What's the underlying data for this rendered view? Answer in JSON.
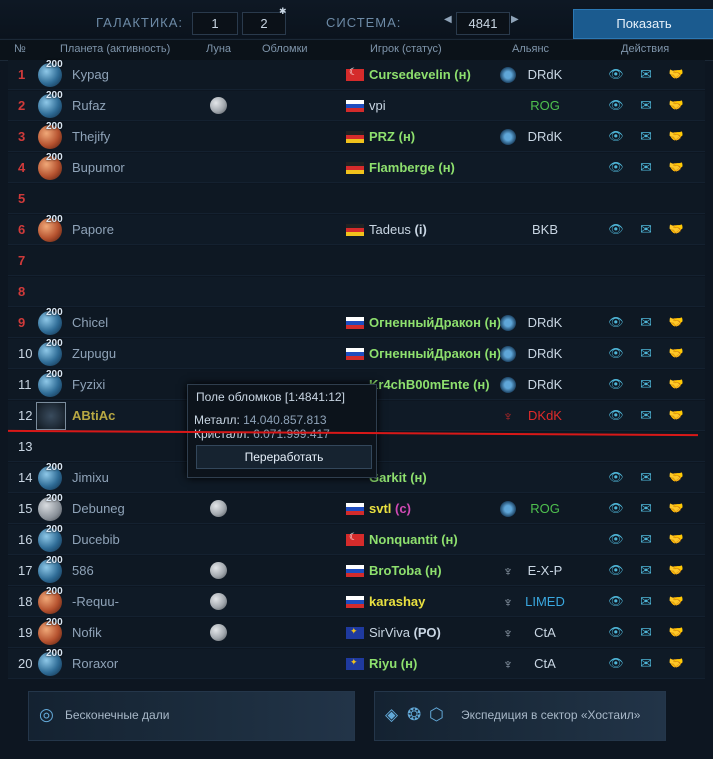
{
  "nav": {
    "galaxy_label": "ГАЛАКТИКА:",
    "galaxy_value": "1",
    "galaxy_value2": "2",
    "system_label": "СИСТЕМА:",
    "system_value": "4841",
    "show_button": "Показать"
  },
  "header": {
    "num": "№",
    "planet": "Планета (активность)",
    "moon": "Луна",
    "debris": "Обломки",
    "player": "Игрок (статус)",
    "alliance": "Альянс",
    "actions": "Действия"
  },
  "rows": [
    {
      "pos": "1",
      "level": "200",
      "planet": "Kypag",
      "planet_type": "earth",
      "moon": false,
      "flag": "tr",
      "player": "Cursedevelin",
      "status": "(н)",
      "player_color": "green",
      "ally_icon": "blue",
      "alliance": "DRdK",
      "alliance_color": "white"
    },
    {
      "pos": "2",
      "level": "200",
      "planet": "Rufaz",
      "planet_type": "earth",
      "moon": true,
      "flag": "ru",
      "player": "vpi",
      "status": "",
      "player_color": "white",
      "ally_icon": "",
      "alliance": "ROG",
      "alliance_color": "green"
    },
    {
      "pos": "3",
      "level": "200",
      "planet": "Thejify",
      "planet_type": "mars",
      "moon": false,
      "flag": "de",
      "player": "PRZ",
      "status": "(н)",
      "player_color": "green",
      "ally_icon": "blue",
      "alliance": "DRdK",
      "alliance_color": "white"
    },
    {
      "pos": "4",
      "level": "200",
      "planet": "Bupumor",
      "planet_type": "mars",
      "moon": false,
      "flag": "de",
      "player": "Flamberge",
      "status": "(н)",
      "player_color": "green",
      "ally_icon": "",
      "alliance": "",
      "alliance_color": "white"
    },
    {
      "pos": "5",
      "empty": true
    },
    {
      "pos": "6",
      "level": "200",
      "planet": "Papore",
      "planet_type": "mars",
      "moon": false,
      "flag": "de",
      "player": "Tadeus",
      "status": "(i)",
      "player_color": "white",
      "ally_icon": "",
      "alliance": "BKB",
      "alliance_color": "white"
    },
    {
      "pos": "7",
      "empty": true
    },
    {
      "pos": "8",
      "empty": true
    },
    {
      "pos": "9",
      "level": "200",
      "planet": "Chicel",
      "planet_type": "earth",
      "moon": false,
      "flag": "ru",
      "player": "ОгненныйДракон",
      "status": "(н)",
      "player_color": "green",
      "ally_icon": "blue",
      "alliance": "DRdK",
      "alliance_color": "white"
    },
    {
      "pos": "10",
      "level": "200",
      "planet": "Zupugu",
      "planet_type": "earth",
      "moon": false,
      "flag": "ru",
      "player": "ОгненныйДракон",
      "status": "(н)",
      "player_color": "green",
      "ally_icon": "blue",
      "alliance": "DRdK",
      "alliance_color": "white"
    },
    {
      "pos": "11",
      "level": "200",
      "planet": "Fyzixi",
      "planet_type": "earth",
      "moon": false,
      "flag": "",
      "player": "Kr4chB00mEnte",
      "status": "(н)",
      "player_color": "green",
      "ally_icon": "blue",
      "alliance": "DRdK",
      "alliance_color": "white"
    },
    {
      "pos": "12",
      "level": "",
      "planet": "ABtiAc",
      "planet_type": "avatar",
      "moon": false,
      "flag": "",
      "player": "",
      "status": "",
      "player_color": "white",
      "ally_icon": "red",
      "alliance": "DKdK",
      "alliance_color": "red"
    },
    {
      "pos": "13",
      "empty": true
    },
    {
      "pos": "14",
      "level": "200",
      "planet": "Jimixu",
      "planet_type": "earth",
      "moon": false,
      "flag": "",
      "player": "Garkit",
      "status": "(н)",
      "player_color": "green",
      "ally_icon": "",
      "alliance": "",
      "alliance_color": "white"
    },
    {
      "pos": "15",
      "level": "200",
      "planet": "Debuneg",
      "planet_type": "ringed",
      "moon": true,
      "flag": "ru",
      "player": "svtl",
      "status": "(с)",
      "player_color": "yellow",
      "ally_icon": "blue",
      "alliance": "ROG",
      "alliance_color": "green"
    },
    {
      "pos": "16",
      "level": "200",
      "planet": "Ducebib",
      "planet_type": "earth",
      "moon": false,
      "flag": "tr",
      "player": "Nonquantit",
      "status": "(н)",
      "player_color": "green",
      "ally_icon": "",
      "alliance": "",
      "alliance_color": "white"
    },
    {
      "pos": "17",
      "level": "200",
      "planet": "586",
      "planet_type": "earth",
      "moon": true,
      "flag": "ru",
      "player": "BroToba",
      "status": "(н)",
      "player_color": "green",
      "ally_icon": "dark",
      "alliance": "E-X-P",
      "alliance_color": "white"
    },
    {
      "pos": "18",
      "level": "200",
      "planet": "-Requu-",
      "planet_type": "mars",
      "moon": true,
      "flag": "ru",
      "player": "karashay",
      "status": "",
      "player_color": "yellow",
      "ally_icon": "dark",
      "alliance": "LIMED",
      "alliance_color": "blue"
    },
    {
      "pos": "19",
      "level": "200",
      "planet": "Nofik",
      "planet_type": "mars",
      "moon": true,
      "flag": "eu",
      "player": "SirViva",
      "status": "(РО)",
      "player_color": "white",
      "ally_icon": "dark",
      "alliance": "CtA",
      "alliance_color": "white"
    },
    {
      "pos": "20",
      "level": "200",
      "planet": "Roraxor",
      "planet_type": "earth",
      "moon": false,
      "flag": "eu",
      "player": "Riyu",
      "status": "(н)",
      "player_color": "green",
      "ally_icon": "dark",
      "alliance": "CtA",
      "alliance_color": "white"
    }
  ],
  "popup": {
    "title": "Поле обломков [1:4841:12]",
    "metal_label": "Металл:",
    "metal_value": "14.040.857.813",
    "crystal_label": "Кристалл:",
    "crystal_value": "6.071.999.417",
    "button": "Переработать"
  },
  "bottom": {
    "left_label": "Бесконечные дали",
    "right_label": "Экспедиция в сектор «Хостаил»"
  },
  "icons": {
    "view": "eye-icon",
    "message": "envelope-icon",
    "buddy": "handshake-icon"
  }
}
